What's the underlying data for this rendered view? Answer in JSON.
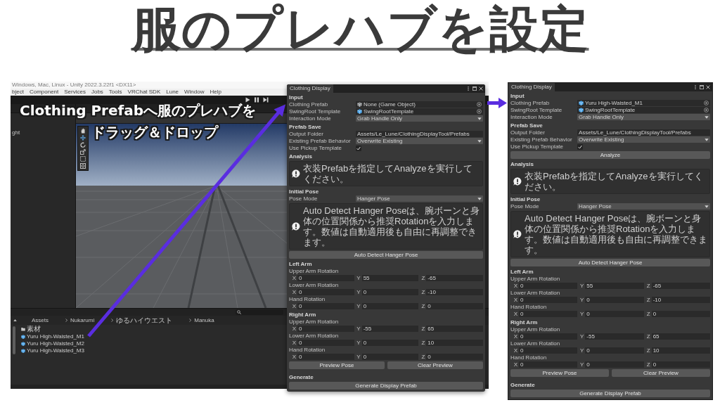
{
  "title": "服のプレハブを設定",
  "editor": {
    "window_title": "Windows, Mac, Linux - Unity 2022.3.22f1 <DX11>",
    "menu": [
      "bject",
      "Component",
      "Services",
      "Jobs",
      "Tools",
      "VRChat SDK",
      "Lune",
      "Window",
      "Help"
    ],
    "hierarchy": [
      "ght"
    ],
    "project": {
      "breadcrumb": [
        "Assets",
        "Nukarumi",
        "ゆるハイウエスト",
        "Manuka"
      ],
      "items": [
        {
          "kind": "folder",
          "name": "素材"
        },
        {
          "kind": "prefab",
          "name": "Yuru High-Waisted_M1"
        },
        {
          "kind": "prefab",
          "name": "Yuru High-Waisted_M2"
        },
        {
          "kind": "prefab",
          "name": "Yuru High-Waisted_M3"
        }
      ]
    }
  },
  "windows": [
    {
      "tab": "Clothing Display",
      "blocks": [
        {
          "kind": "heading",
          "text": "Input"
        },
        {
          "kind": "object",
          "label": "Clothing Prefab",
          "value": "None (Game Object)",
          "assigned": false
        },
        {
          "kind": "object",
          "label": "SwingRoot Template",
          "value": "SwingRootTemplate",
          "assigned": true
        },
        {
          "kind": "dropdown",
          "label": "Interaction Mode",
          "value": "Grab Handle Only"
        },
        {
          "kind": "heading",
          "text": "Prefab Save"
        },
        {
          "kind": "text",
          "label": "Output Folder",
          "value": "Assets/Le_Lune/ClothingDisplayTool/Prefabs"
        },
        {
          "kind": "dropdown",
          "label": "Existing Prefab Behavior",
          "value": "Overwrite Existing"
        },
        {
          "kind": "toggle",
          "label": "Use Pickup Template",
          "checked": true
        },
        {
          "kind": "heading",
          "text": "Analysis"
        },
        {
          "kind": "help",
          "text": "衣装Prefabを指定してAnalyzeを実行してください。"
        },
        {
          "kind": "heading",
          "text": "Initial Pose"
        },
        {
          "kind": "dropdown",
          "label": "Pose Mode",
          "value": "Hanger Pose"
        },
        {
          "kind": "help",
          "text": "Auto Detect Hanger Poseは、腕ボーンと身体の位置関係から推奨Rotationを入力します。数値は自動適用後も自由に再調整できます。"
        },
        {
          "kind": "buttons",
          "labels": [
            "Auto Detect Hanger Pose"
          ]
        },
        {
          "kind": "heading",
          "text": "Left Arm"
        },
        {
          "kind": "vector",
          "label": "Upper Arm Rotation",
          "axes": [
            {
              "axis": "X",
              "value": "0"
            },
            {
              "axis": "Y",
              "value": "55"
            },
            {
              "axis": "Z",
              "value": "-65"
            }
          ]
        },
        {
          "kind": "vector",
          "label": "Lower Arm Rotation",
          "axes": [
            {
              "axis": "X",
              "value": "0"
            },
            {
              "axis": "Y",
              "value": "0"
            },
            {
              "axis": "Z",
              "value": "-10"
            }
          ]
        },
        {
          "kind": "vector",
          "label": "Hand Rotation",
          "axes": [
            {
              "axis": "X",
              "value": "0"
            },
            {
              "axis": "Y",
              "value": "0"
            },
            {
              "axis": "Z",
              "value": "0"
            }
          ]
        },
        {
          "kind": "heading",
          "text": "Right Arm"
        },
        {
          "kind": "vector",
          "label": "Upper Arm Rotation",
          "axes": [
            {
              "axis": "X",
              "value": "0"
            },
            {
              "axis": "Y",
              "value": "-55"
            },
            {
              "axis": "Z",
              "value": "65"
            }
          ]
        },
        {
          "kind": "vector",
          "label": "Lower Arm Rotation",
          "axes": [
            {
              "axis": "X",
              "value": "0"
            },
            {
              "axis": "Y",
              "value": "0"
            },
            {
              "axis": "Z",
              "value": "10"
            }
          ]
        },
        {
          "kind": "vector",
          "label": "Hand Rotation",
          "axes": [
            {
              "axis": "X",
              "value": "0"
            },
            {
              "axis": "Y",
              "value": "0"
            },
            {
              "axis": "Z",
              "value": "0"
            }
          ]
        },
        {
          "kind": "buttons",
          "labels": [
            "Preview Pose",
            "Clear Preview"
          ]
        },
        {
          "kind": "heading",
          "text": "Generate"
        },
        {
          "kind": "buttons",
          "labels": [
            "Generate Display Prefab"
          ]
        }
      ]
    },
    {
      "tab": "Clothing Display",
      "blocks": [
        {
          "kind": "heading",
          "text": "Input"
        },
        {
          "kind": "object",
          "label": "Clothing Prefab",
          "value": "Yuru High-Waisted_M1",
          "assigned": true
        },
        {
          "kind": "object",
          "label": "SwingRoot Template",
          "value": "SwingRootTemplate",
          "assigned": true
        },
        {
          "kind": "dropdown",
          "label": "Interaction Mode",
          "value": "Grab Handle Only"
        },
        {
          "kind": "heading",
          "text": "Prefab Save"
        },
        {
          "kind": "text",
          "label": "Output Folder",
          "value": "Assets/Le_Lune/ClothingDisplayTool/Prefabs"
        },
        {
          "kind": "dropdown",
          "label": "Existing Prefab Behavior",
          "value": "Overwrite Existing"
        },
        {
          "kind": "toggle",
          "label": "Use Pickup Template",
          "checked": true
        },
        {
          "kind": "buttons",
          "labels": [
            "Analyze"
          ]
        },
        {
          "kind": "heading",
          "text": "Analysis"
        },
        {
          "kind": "help",
          "text": "衣装Prefabを指定してAnalyzeを実行してください。"
        },
        {
          "kind": "heading",
          "text": "Initial Pose"
        },
        {
          "kind": "dropdown",
          "label": "Pose Mode",
          "value": "Hanger Pose"
        },
        {
          "kind": "help",
          "text": "Auto Detect Hanger Poseは、腕ボーンと身体の位置関係から推奨Rotationを入力します。数値は自動適用後も自由に再調整できます。"
        },
        {
          "kind": "buttons",
          "labels": [
            "Auto Detect Hanger Pose"
          ]
        },
        {
          "kind": "heading",
          "text": "Left Arm"
        },
        {
          "kind": "vector",
          "label": "Upper Arm Rotation",
          "axes": [
            {
              "axis": "X",
              "value": "0"
            },
            {
              "axis": "Y",
              "value": "55"
            },
            {
              "axis": "Z",
              "value": "-65"
            }
          ]
        },
        {
          "kind": "vector",
          "label": "Lower Arm Rotation",
          "axes": [
            {
              "axis": "X",
              "value": "0"
            },
            {
              "axis": "Y",
              "value": "0"
            },
            {
              "axis": "Z",
              "value": "-10"
            }
          ]
        },
        {
          "kind": "vector",
          "label": "Hand Rotation",
          "axes": [
            {
              "axis": "X",
              "value": "0"
            },
            {
              "axis": "Y",
              "value": "0"
            },
            {
              "axis": "Z",
              "value": "0"
            }
          ]
        },
        {
          "kind": "heading",
          "text": "Right Arm"
        },
        {
          "kind": "vector",
          "label": "Upper Arm Rotation",
          "axes": [
            {
              "axis": "X",
              "value": "0"
            },
            {
              "axis": "Y",
              "value": "-55"
            },
            {
              "axis": "Z",
              "value": "65"
            }
          ]
        },
        {
          "kind": "vector",
          "label": "Lower Arm Rotation",
          "axes": [
            {
              "axis": "X",
              "value": "0"
            },
            {
              "axis": "Y",
              "value": "0"
            },
            {
              "axis": "Z",
              "value": "10"
            }
          ]
        },
        {
          "kind": "vector",
          "label": "Hand Rotation",
          "axes": [
            {
              "axis": "X",
              "value": "0"
            },
            {
              "axis": "Y",
              "value": "0"
            },
            {
              "axis": "Z",
              "value": "0"
            }
          ]
        },
        {
          "kind": "buttons",
          "labels": [
            "Preview Pose",
            "Clear Preview"
          ]
        },
        {
          "kind": "heading",
          "text": "Generate"
        },
        {
          "kind": "buttons",
          "labels": [
            "Generate Display Prefab"
          ]
        }
      ]
    }
  ],
  "caption": [
    "Clothing Prefabへ服のプレハブを",
    "ドラッグ＆ドロップ"
  ]
}
